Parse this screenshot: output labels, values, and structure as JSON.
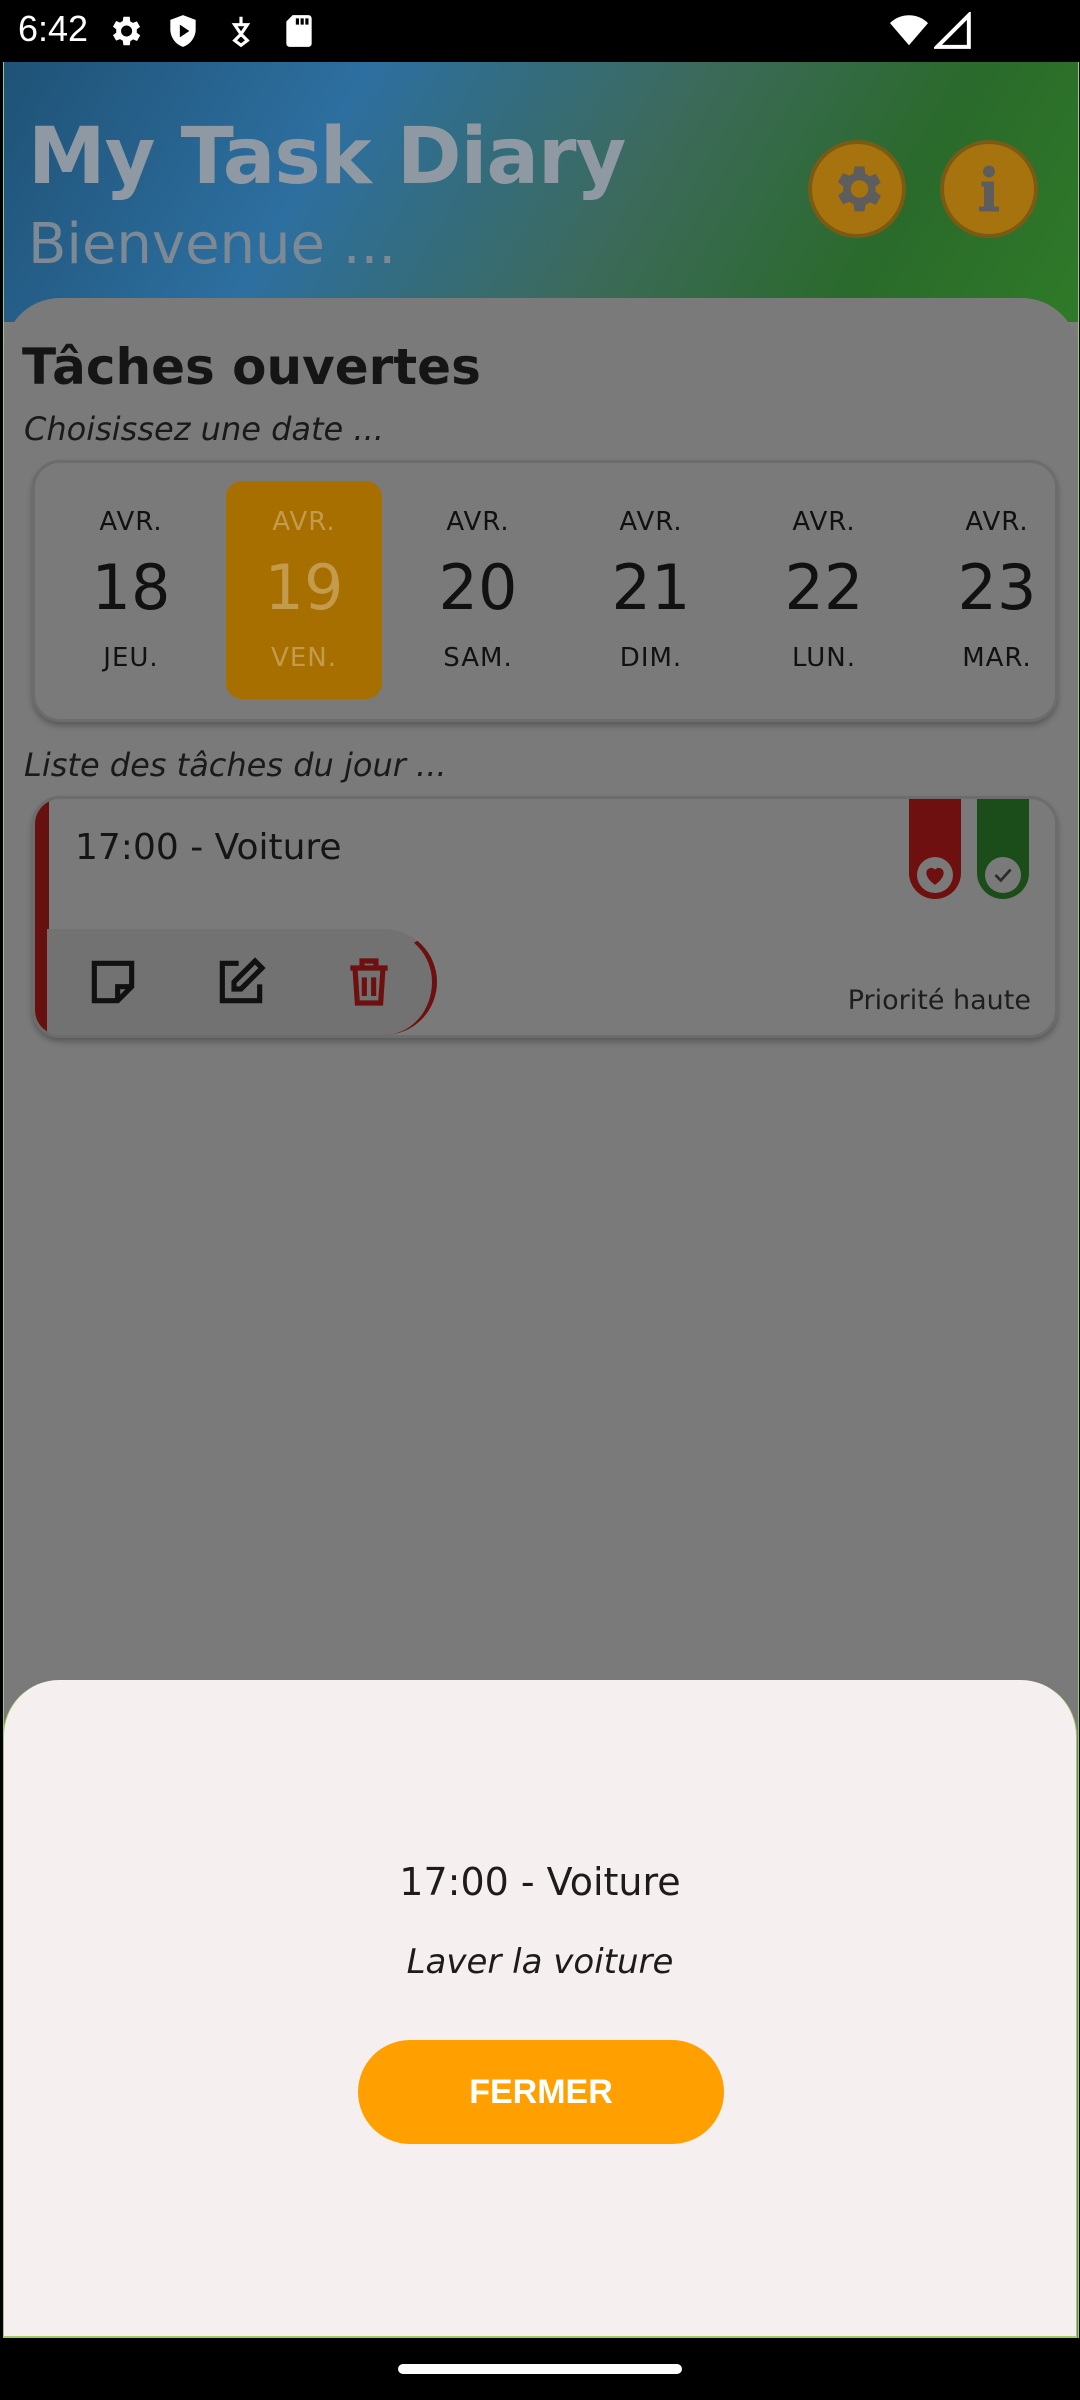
{
  "status_bar": {
    "time": "6:42",
    "left_icons": [
      "gear-icon",
      "shield-play-icon",
      "pet-tag-icon",
      "sd-card-icon"
    ],
    "right_icons": [
      "wifi-icon",
      "signal-icon"
    ]
  },
  "header": {
    "title": "My Task Diary",
    "subtitle": "Bienvenue ...",
    "settings_icon": "gear-icon",
    "info_icon": "info-icon"
  },
  "main": {
    "section_title": "Tâches ouvertes",
    "date_hint": "Choisissez une date ...",
    "dates": [
      {
        "month": "AVR.",
        "day": "18",
        "weekday": "JEU.",
        "selected": false
      },
      {
        "month": "AVR.",
        "day": "19",
        "weekday": "VEN.",
        "selected": true
      },
      {
        "month": "AVR.",
        "day": "20",
        "weekday": "SAM.",
        "selected": false
      },
      {
        "month": "AVR.",
        "day": "21",
        "weekday": "DIM.",
        "selected": false
      },
      {
        "month": "AVR.",
        "day": "22",
        "weekday": "LUN.",
        "selected": false
      },
      {
        "month": "AVR.",
        "day": "23",
        "weekday": "MAR.",
        "selected": false
      }
    ],
    "list_hint": "Liste des tâches du jour ...",
    "task": {
      "title": "17:00 - Voiture",
      "priority": "Priorité haute",
      "flags": [
        "heart-icon",
        "check-icon"
      ],
      "actions": [
        "note-icon",
        "edit-icon",
        "trash-icon"
      ]
    }
  },
  "sheet": {
    "title": "17:00 - Voiture",
    "description": "Laver la voiture",
    "close_label": "FERMER"
  },
  "colors": {
    "accent": "#ffa000",
    "priority_red": "#6e1010",
    "done_green": "#1b4d1b",
    "sheet_bg": "#f5efef"
  }
}
